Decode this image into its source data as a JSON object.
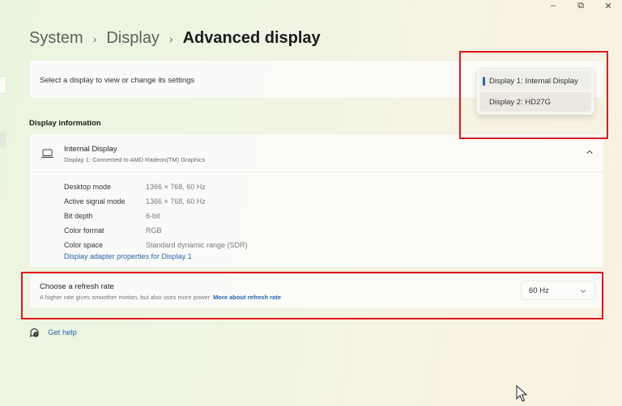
{
  "window": {
    "controls": {
      "minimize": "–",
      "restore": "⧉",
      "close": "✕"
    }
  },
  "breadcrumb": {
    "items": [
      "System",
      "Display"
    ],
    "separator": "›",
    "current": "Advanced display"
  },
  "display_select": {
    "label": "Select a display to view or change its settings",
    "options": [
      {
        "label": "Display 1: Internal Display",
        "selected": true
      },
      {
        "label": "Display 2: HD27G",
        "selected": false
      }
    ]
  },
  "display_information": {
    "section_title": "Display information",
    "name": "Internal Display",
    "subtitle": "Display 1: Connected to AMD Radeon(TM) Graphics",
    "icon": "laptop-icon",
    "expanded": true,
    "rows": [
      {
        "key": "Desktop mode",
        "value": "1366 × 768, 60 Hz"
      },
      {
        "key": "Active signal mode",
        "value": "1366 × 768, 60 Hz"
      },
      {
        "key": "Bit depth",
        "value": "6-bit"
      },
      {
        "key": "Color format",
        "value": "RGB"
      },
      {
        "key": "Color space",
        "value": "Standard dynamic range (SDR)"
      }
    ],
    "adapter_link": "Display adapter properties for Display 1"
  },
  "refresh_rate": {
    "title": "Choose a refresh rate",
    "description": "A higher rate gives smoother motion, but also uses more power",
    "link": "More about refresh rate",
    "selected": "60 Hz"
  },
  "help": {
    "label": "Get help",
    "icon": "help-chat-icon"
  },
  "colors": {
    "accent": "#2b63b8",
    "link": "#2a5fae",
    "highlight_box": "#e0161c"
  }
}
